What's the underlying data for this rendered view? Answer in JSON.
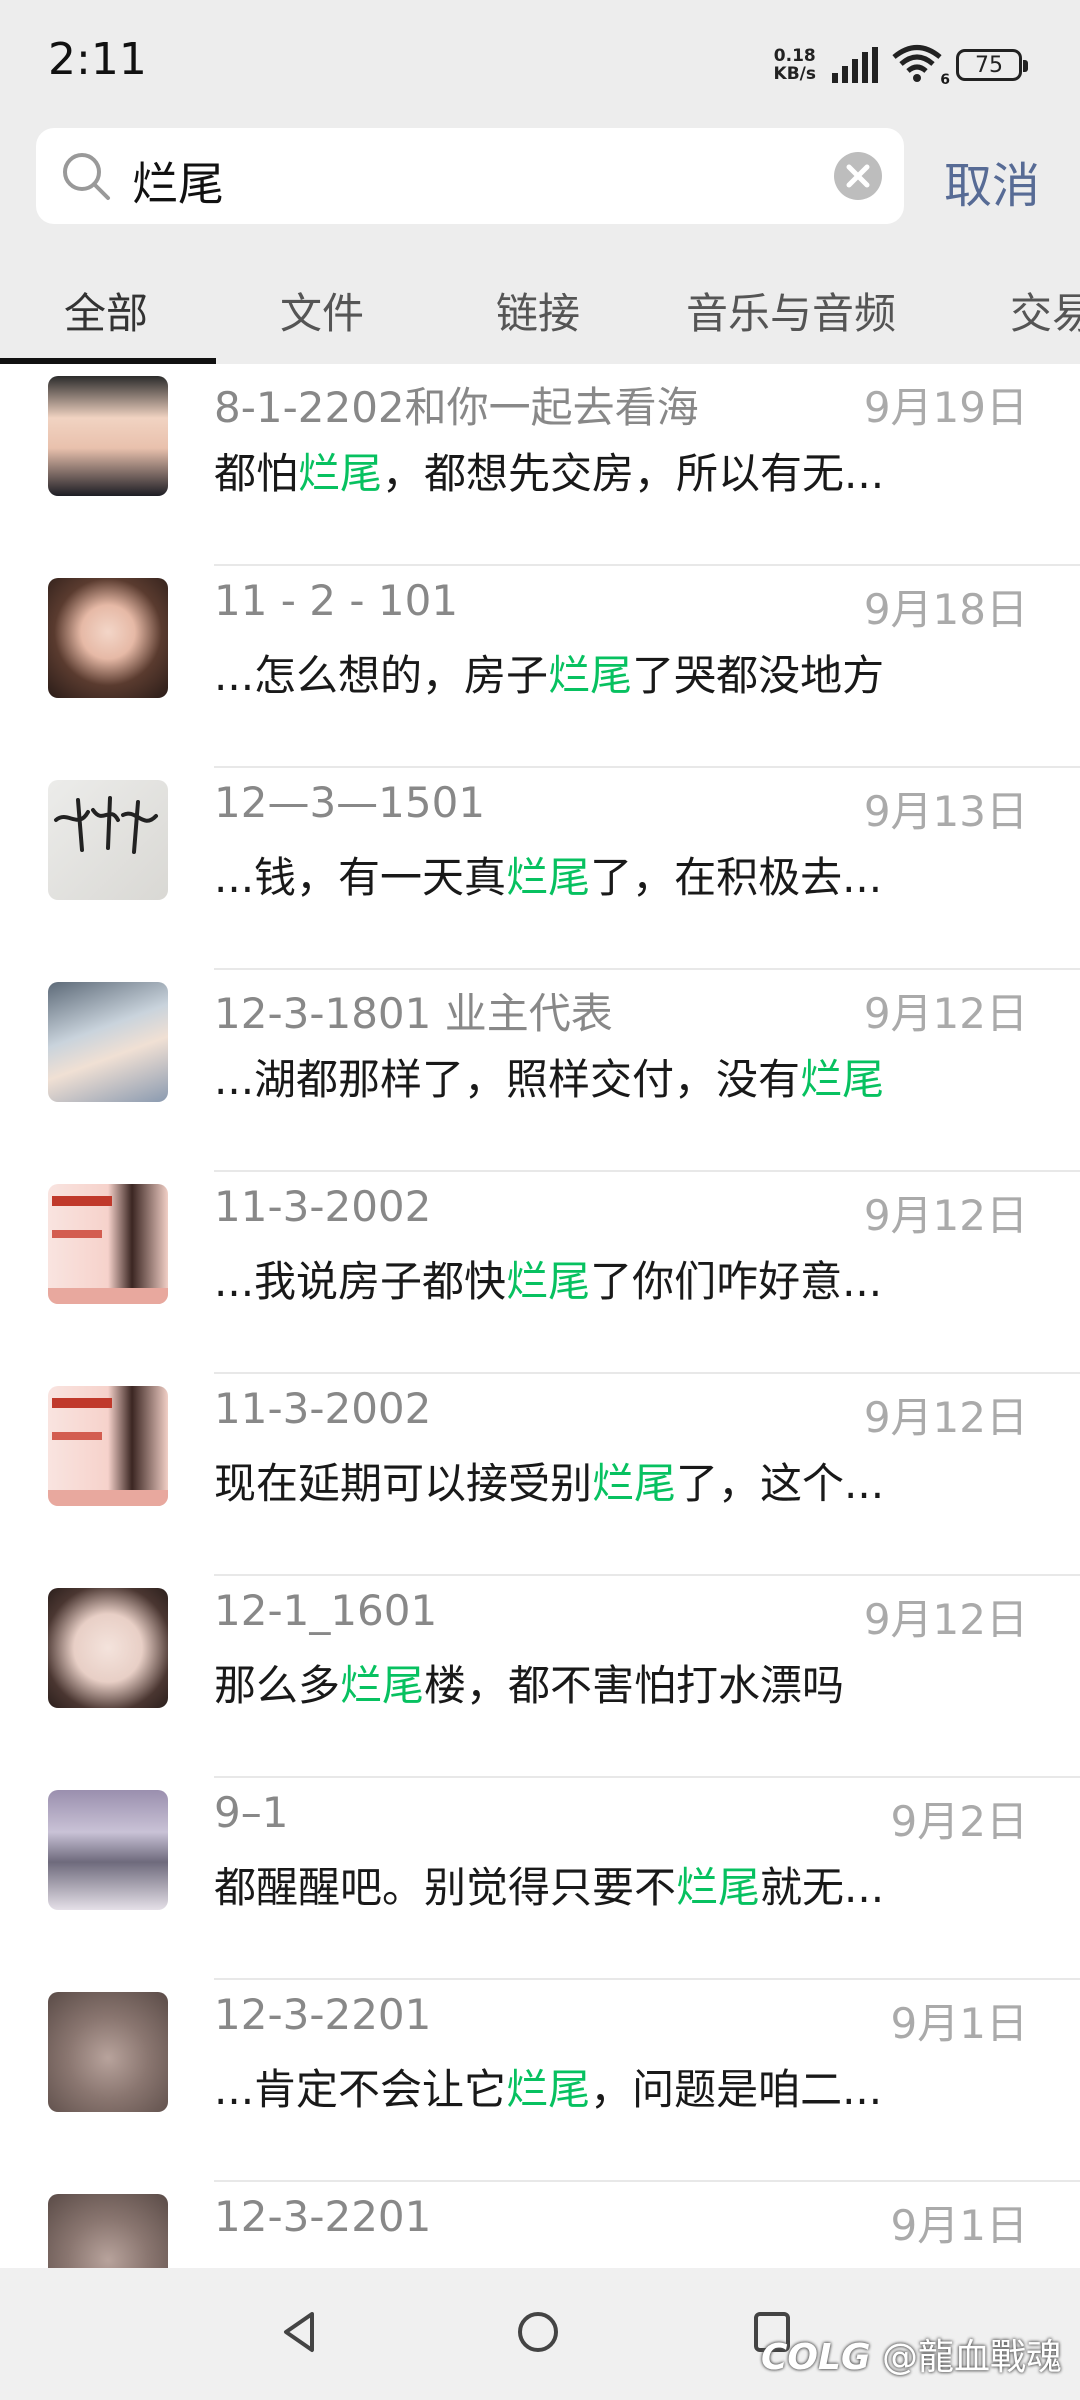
{
  "status_bar": {
    "time": "2:11",
    "net_speed_value": "0.18",
    "net_speed_unit": "KB/s",
    "wifi_label": "6",
    "battery_level": "75"
  },
  "search": {
    "query": "烂尾",
    "cancel_label": "取消"
  },
  "tabs": [
    {
      "label": "全部",
      "selected": true
    },
    {
      "label": "文件",
      "selected": false
    },
    {
      "label": "链接",
      "selected": false
    },
    {
      "label": "音乐与音频",
      "selected": false
    },
    {
      "label": "交易",
      "selected": false
    }
  ],
  "highlight_color": "#07c160",
  "results": [
    {
      "title": "8-1-2202和你一起去看海",
      "date": "9月19日",
      "pre": "都怕",
      "hl": "烂尾",
      "post": "，都想先交房，所以有无..."
    },
    {
      "title": "11 - 2 - 101",
      "date": "9月18日",
      "pre": "...怎么想的，房子",
      "hl": "烂尾",
      "post": "了哭都没地方"
    },
    {
      "title": "12—3—1501",
      "date": "9月13日",
      "pre": "...钱，有一天真",
      "hl": "烂尾",
      "post": "了，在积极去..."
    },
    {
      "title": "12-3-1801 业主代表",
      "date": "9月12日",
      "pre": "...湖都那样了，照样交付，没有",
      "hl": "烂尾",
      "post": ""
    },
    {
      "title": "11-3-2002",
      "date": "9月12日",
      "pre": "...我说房子都快",
      "hl": "烂尾",
      "post": "了你们咋好意..."
    },
    {
      "title": "11-3-2002",
      "date": "9月12日",
      "pre": "现在延期可以接受别",
      "hl": "烂尾",
      "post": "了，这个..."
    },
    {
      "title": "12-1_1601",
      "date": "9月12日",
      "pre": "那么多",
      "hl": "烂尾",
      "post": "楼，都不害怕打水漂吗"
    },
    {
      "title": "9–1",
      "date": "9月2日",
      "pre": "都醒醒吧。别觉得只要不",
      "hl": "烂尾",
      "post": "就无..."
    },
    {
      "title": "12-3-2201",
      "date": "9月1日",
      "pre": "...肯定不会让它",
      "hl": "烂尾",
      "post": "，问题是咱二..."
    },
    {
      "title": "12-3-2201",
      "date": "9月1日",
      "pre": "",
      "hl": "",
      "post": ""
    }
  ],
  "watermark": "@龍血戰魂",
  "watermark_logo": "COLG"
}
